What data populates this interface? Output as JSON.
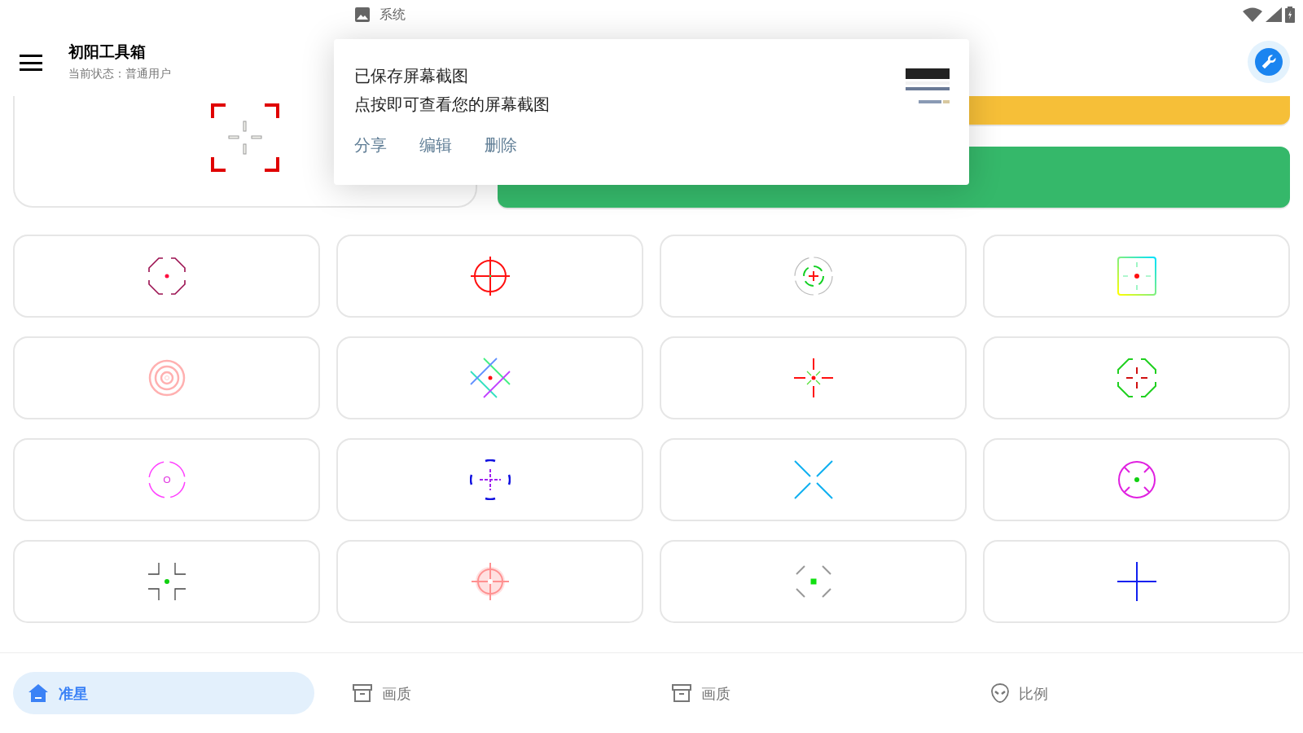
{
  "status_bar": {
    "notification_app": "系统"
  },
  "app_bar": {
    "title": "初阳工具箱",
    "subtitle": "当前状态：普通用户"
  },
  "preview": {
    "kind": "corner-brackets"
  },
  "notification": {
    "title": "已保存屏幕截图",
    "text": "点按即可查看您的屏幕截图",
    "actions": [
      "分享",
      "编辑",
      "删除"
    ]
  },
  "reticles": [
    {
      "kind": "octagon-dot"
    },
    {
      "kind": "circle-cross"
    },
    {
      "kind": "double-ring"
    },
    {
      "kind": "gradient-square"
    },
    {
      "kind": "glow-rings"
    },
    {
      "kind": "diamond-lines"
    },
    {
      "kind": "star-cross"
    },
    {
      "kind": "octagon-cross"
    },
    {
      "kind": "dashed-circle"
    },
    {
      "kind": "arc-cross"
    },
    {
      "kind": "cyan-x"
    },
    {
      "kind": "ring-dot"
    },
    {
      "kind": "corner-ticks"
    },
    {
      "kind": "glow-crosshair"
    },
    {
      "kind": "diagonal-ticks"
    },
    {
      "kind": "blue-cross"
    }
  ],
  "bottom_nav": [
    {
      "label": "准星",
      "kind": "home",
      "selected": true
    },
    {
      "label": "画质",
      "kind": "archive",
      "selected": false
    },
    {
      "label": "画质",
      "kind": "archive",
      "selected": false
    },
    {
      "label": "比例",
      "kind": "alien",
      "selected": false
    }
  ]
}
